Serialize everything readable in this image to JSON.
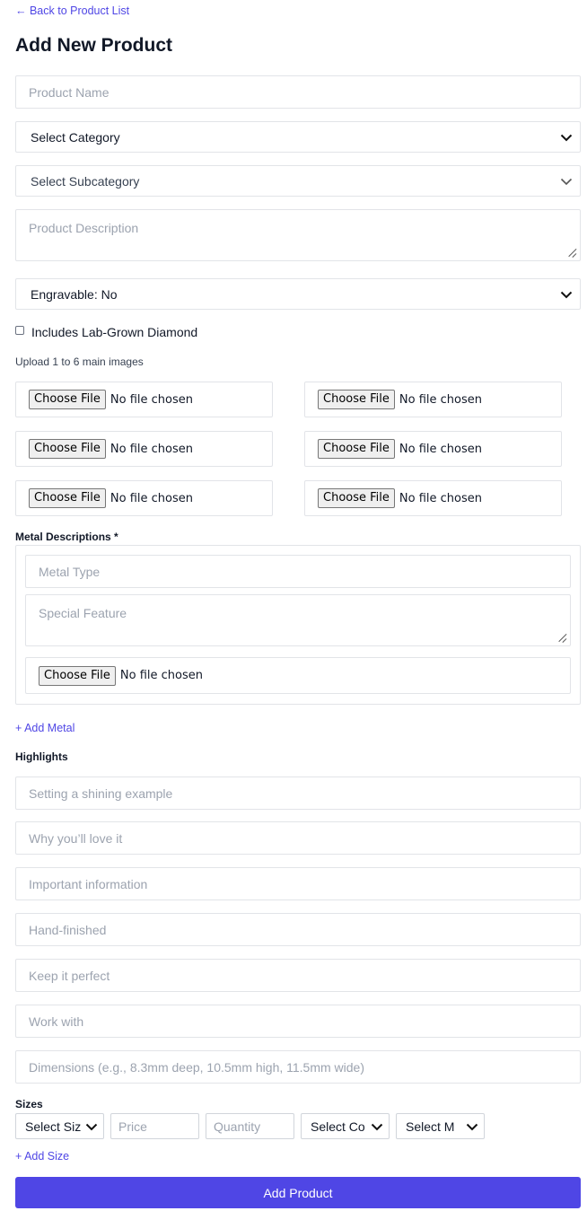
{
  "nav": {
    "back_label": "← Back to Product List"
  },
  "page": {
    "title": "Add New Product"
  },
  "form": {
    "product_name_placeholder": "Product Name",
    "category_select": "Select Category",
    "subcategory_select": "Select Subcategory",
    "description_placeholder": "Product Description",
    "engravable_select": "Engravable: No",
    "lab_grown_label": "Includes Lab-Grown Diamond",
    "lab_grown_checked": false,
    "upload_hint": "Upload 1 to 6 main images",
    "file_inputs": [
      {
        "button": "Choose File",
        "status": "No file chosen"
      },
      {
        "button": "Choose File",
        "status": "No file chosen"
      },
      {
        "button": "Choose File",
        "status": "No file chosen"
      },
      {
        "button": "Choose File",
        "status": "No file chosen"
      },
      {
        "button": "Choose File",
        "status": "No file chosen"
      },
      {
        "button": "Choose File",
        "status": "No file chosen"
      }
    ]
  },
  "metal": {
    "section_label": "Metal Descriptions *",
    "metal_type_placeholder": "Metal Type",
    "special_feature_placeholder": "Special Feature",
    "file": {
      "button": "Choose File",
      "status": "No file chosen"
    },
    "add_label": "+ Add Metal"
  },
  "highlights": {
    "section_label": "Highlights",
    "fields": [
      "Setting a shining example",
      "Why you’ll love it",
      "Important information",
      "Hand-finished",
      "Keep it perfect",
      "Work with",
      "Dimensions (e.g., 8.3mm deep, 10.5mm high, 11.5mm wide)"
    ]
  },
  "sizes": {
    "section_label": "Sizes",
    "size_select": "Select Siz",
    "price_placeholder": "Price",
    "quantity_placeholder": "Quantity",
    "color_select": "Select Co",
    "metal_select": "Select M",
    "add_label": "+ Add Size"
  },
  "submit": {
    "label": "Add Product"
  },
  "colors": {
    "accent": "#4f46e5",
    "border": "#e2e4e8",
    "placeholder": "#9ca3af"
  }
}
